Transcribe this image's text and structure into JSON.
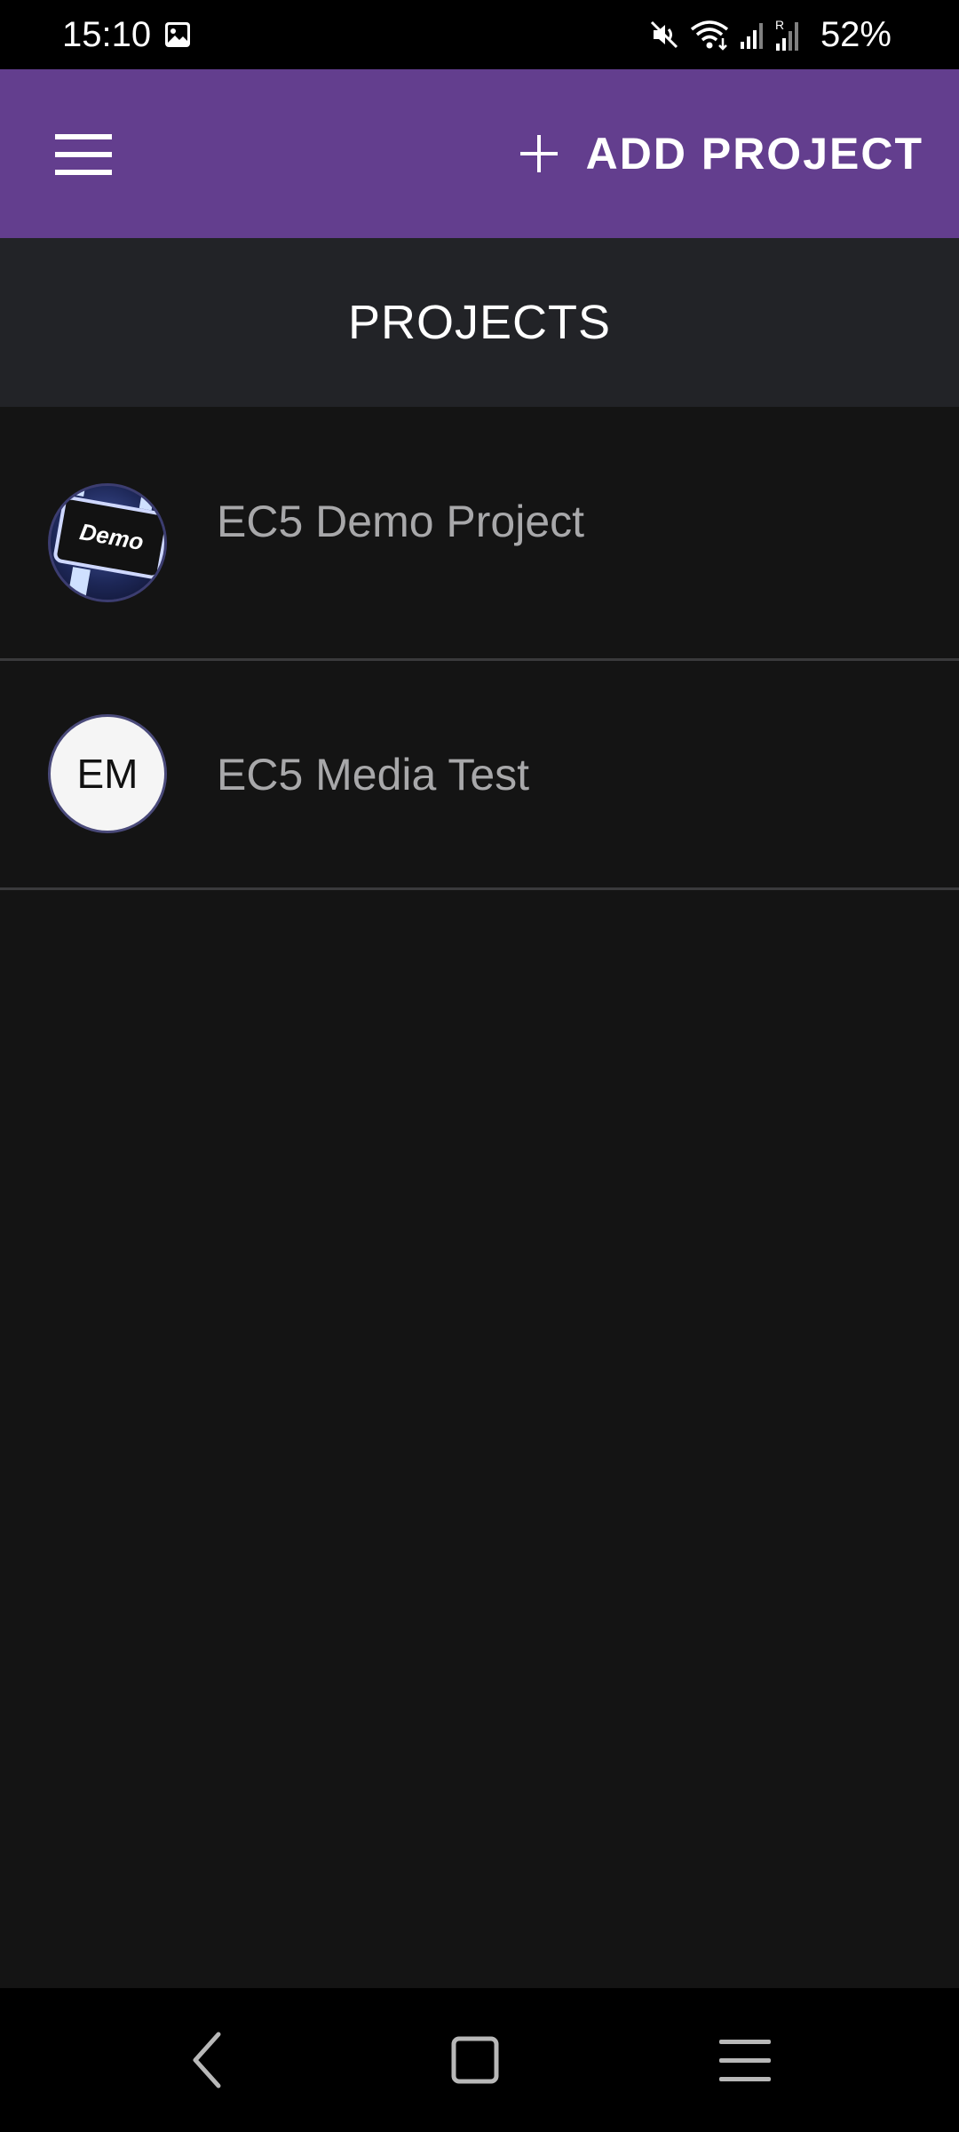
{
  "status_bar": {
    "time": "15:10",
    "battery": "52%",
    "icons": [
      "gallery-notification-icon",
      "mute-icon",
      "wifi-icon",
      "signal-icon",
      "roaming-signal-icon"
    ]
  },
  "app_bar": {
    "menu_icon": "hamburger-menu-icon",
    "add_project_icon": "plus-icon",
    "add_project_label": "ADD PROJECT",
    "background_color": "#633e8e"
  },
  "section": {
    "title": "PROJECTS"
  },
  "projects": [
    {
      "name": "EC5 Demo Project",
      "avatar_type": "image",
      "avatar_text": "Demo"
    },
    {
      "name": "EC5 Media Test",
      "avatar_type": "initials",
      "avatar_text": "EM"
    }
  ],
  "nav_bar": {
    "icons": [
      "back-icon",
      "home-icon",
      "recents-icon"
    ]
  },
  "colors": {
    "accent": "#633e8e",
    "background": "#141414",
    "header_background": "#222327",
    "divider": "#3a3a3c"
  }
}
